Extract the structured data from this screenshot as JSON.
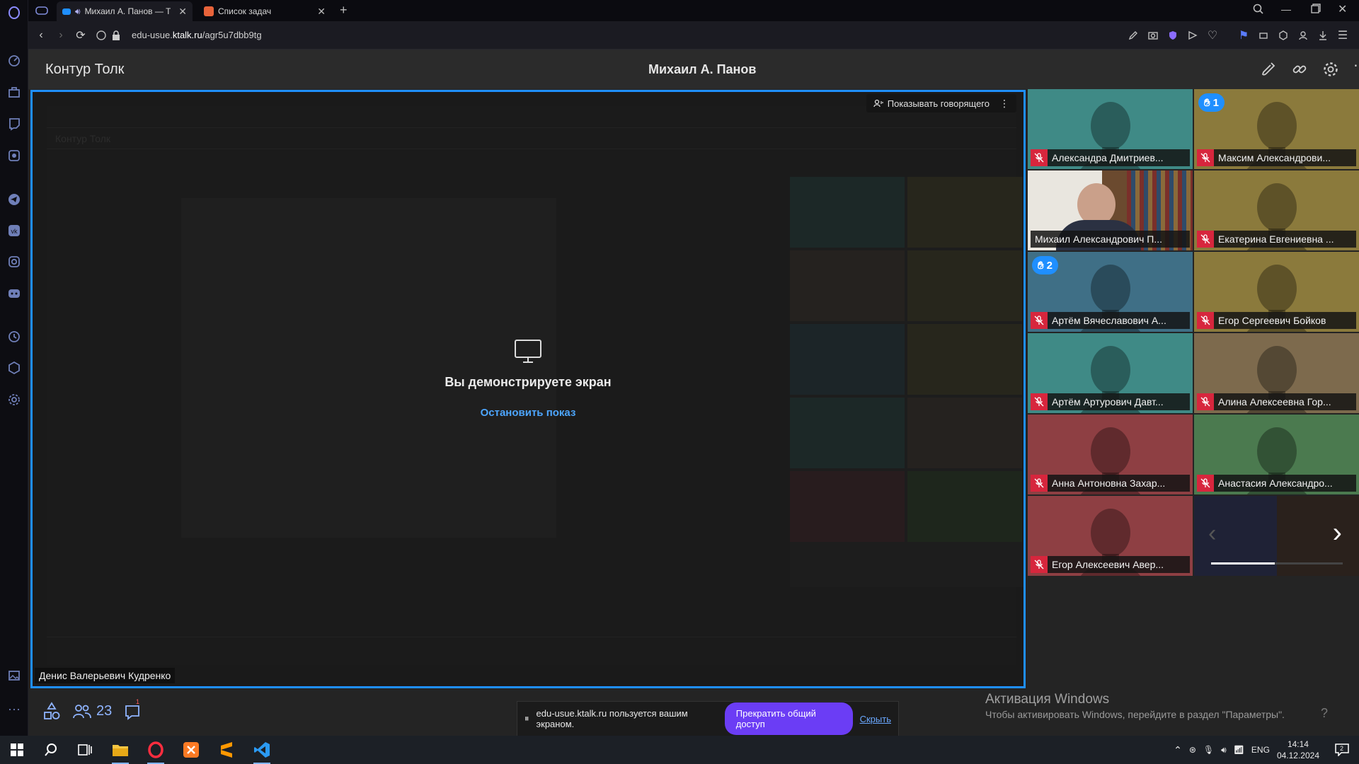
{
  "browser": {
    "tabs": [
      {
        "label": "Михаил А. Панов — Т",
        "active": true
      },
      {
        "label": "Список задач",
        "active": false
      }
    ],
    "url_prefix": "edu-usue.",
    "url_domain": "ktalk.ru",
    "url_path": "/agr5u7dbb9tg"
  },
  "app": {
    "brand": "Контур Толк",
    "title": "Михаил А. Панов"
  },
  "stage": {
    "show_speaker": "Показывать говорящего",
    "sharing_text": "Вы демонстрируете экран",
    "stop_show": "Остановить показ",
    "presenter": "Денис Валерьевич Кудренко"
  },
  "participants": [
    {
      "name": "Александра Дмитриев...",
      "color": "#3f8a86",
      "hand": "",
      "video": false
    },
    {
      "name": "Максим Александрови...",
      "color": "#8b7a3c",
      "hand": "1",
      "video": false
    },
    {
      "name": "Михаил Александрович П...",
      "color": "#5d4a36",
      "hand": "",
      "video": true
    },
    {
      "name": "Екатерина Евгениевна ...",
      "color": "#8b7a3c",
      "hand": "",
      "video": false
    },
    {
      "name": "Артём Вячеславович А...",
      "color": "#3f6f86",
      "hand": "2",
      "video": false
    },
    {
      "name": "Егор Сергеевич Бойков",
      "color": "#8b7a3c",
      "hand": "",
      "video": false
    },
    {
      "name": "Артём Артурович Давт...",
      "color": "#3f8a86",
      "hand": "",
      "video": false
    },
    {
      "name": "Алина Алексеевна Гор...",
      "color": "#7d6a4d",
      "hand": "",
      "video": false
    },
    {
      "name": "Анна Антоновна Захар...",
      "color": "#8e3f43",
      "hand": "",
      "video": false
    },
    {
      "name": "Анастасия Александро...",
      "color": "#4b7a4f",
      "hand": "",
      "video": false
    },
    {
      "name": "Егор Алексеевич Авер...",
      "color": "#8e3f43",
      "hand": "",
      "video": false
    }
  ],
  "toolbar": {
    "participants_count": "23",
    "chat_badge": "1"
  },
  "banner": {
    "text": "edu-usue.ktalk.ru пользуется вашим экраном.",
    "stop": "Прекратить общий доступ",
    "hide": "Скрыть"
  },
  "windows": {
    "activate_title": "Активация Windows",
    "activate_text": "Чтобы активировать Windows, перейдите в раздел \"Параметры\".",
    "lang": "ENG",
    "time": "14:14",
    "date": "04.12.2024",
    "notifications": "2"
  },
  "colors": {
    "accent": "#1f8fff",
    "stop_button": "#6b3df5",
    "mic_off": "#d7263d"
  }
}
